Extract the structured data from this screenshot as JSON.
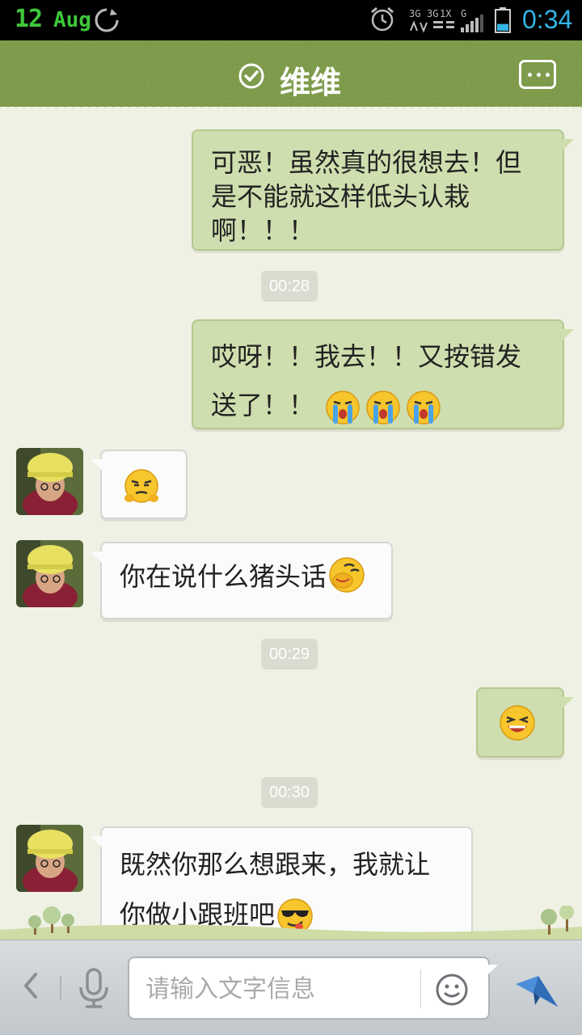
{
  "status_bar": {
    "day": "12",
    "month": "Aug",
    "time": "0:34",
    "network_labels": [
      "3G",
      "3G",
      "1X",
      "G"
    ],
    "icons": [
      "sync-icon",
      "alarm-icon",
      "signal-icon",
      "battery-icon"
    ],
    "battery_level": 0.35
  },
  "header": {
    "title": "维维",
    "verified_icon": "check-circle-icon",
    "menu_icon": "more-icon"
  },
  "messages": [
    {
      "side": "out",
      "text": "可恶！虽然真的很想去！但是不能就这样低头认栽啊！！！"
    },
    {
      "type": "time",
      "text": "00:28"
    },
    {
      "side": "out",
      "text": "哎呀！！我去！！又按错发送了！！",
      "emojis": [
        "crying-emoji",
        "crying-emoji",
        "crying-emoji"
      ]
    },
    {
      "side": "in",
      "text": "",
      "emojis": [
        "smirk-emoji"
      ]
    },
    {
      "side": "in",
      "text": "你在说什么猪头话",
      "emojis": [
        "yawn-emoji"
      ]
    },
    {
      "type": "time",
      "text": "00:29"
    },
    {
      "side": "out",
      "text": "",
      "emojis": [
        "laughing-emoji"
      ]
    },
    {
      "type": "time",
      "text": "00:30"
    },
    {
      "side": "in",
      "text": "既然你那么想跟来，我就让你做小跟班吧",
      "emojis": [
        "cool-sunglasses-emoji"
      ]
    }
  ],
  "msg_lines": {
    "m1": [
      "可恶！虽然真的很想去！但",
      "是不能就这样低头认栽",
      "啊！！！"
    ],
    "m3": [
      "哎呀！！我去！！又按错发",
      "送了！！"
    ],
    "m5": "你在说什么猪头话",
    "m9": [
      "既然你那么想跟来，我就让",
      "你做小跟班吧"
    ]
  },
  "input_bar": {
    "placeholder": "请输入文字信息",
    "value": "",
    "icons": [
      "back-icon",
      "microphone-icon",
      "smiley-icon",
      "send-icon"
    ]
  },
  "colors": {
    "header": "#7d9b4a",
    "outgoing_bubble": "#cfdeae",
    "incoming_bubble": "#fbfbfb",
    "background": "#eef1e3",
    "time_accent": "#33b5e5",
    "date_accent": "#3ec83a"
  }
}
